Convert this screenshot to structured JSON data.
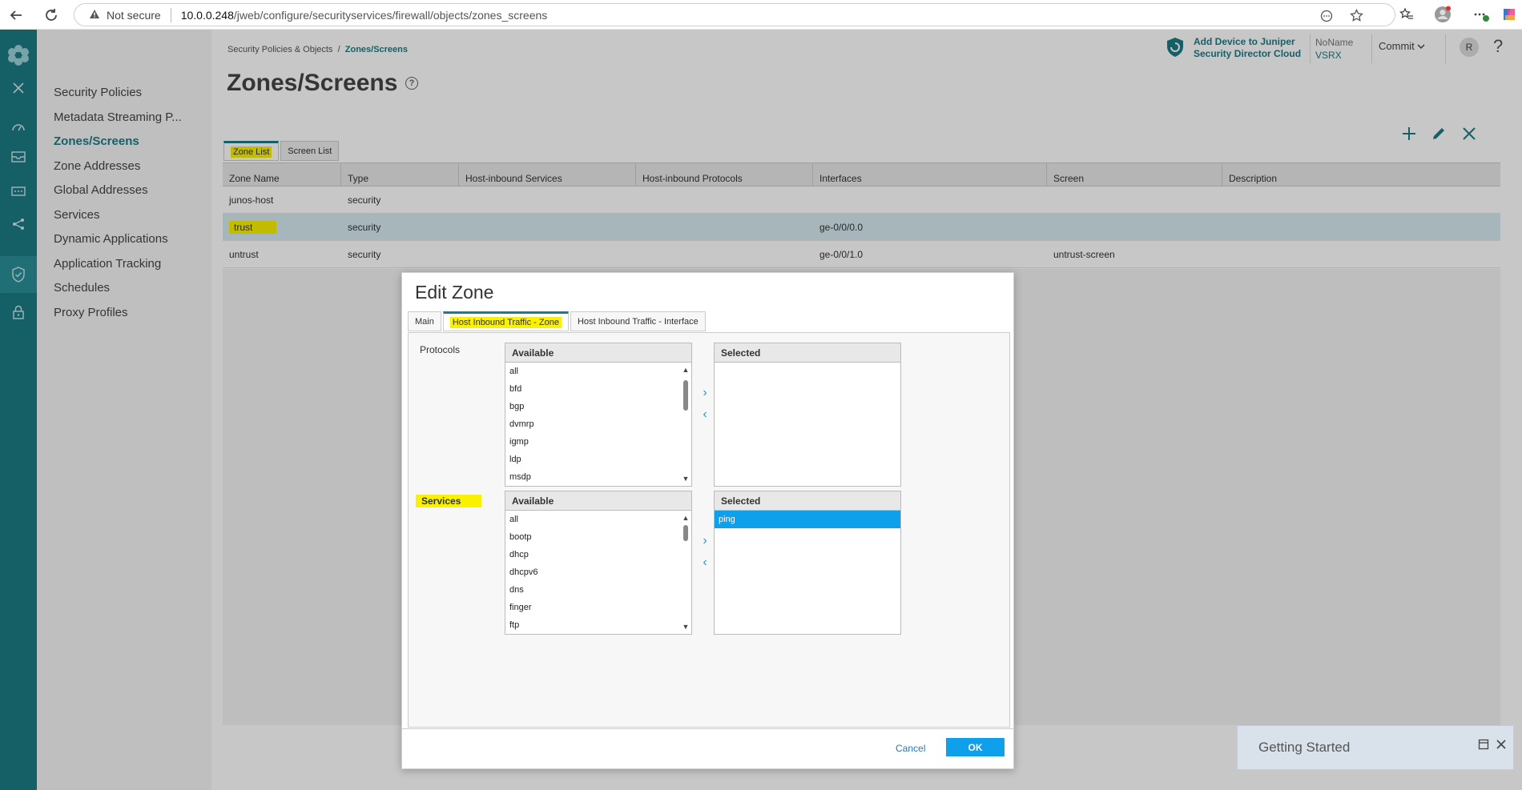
{
  "browser": {
    "not_secure": "Not secure",
    "url_host": "10.0.0.248",
    "url_path": "/jweb/configure/securityservices/firewall/objects/zones_screens"
  },
  "nav": {
    "items": [
      {
        "label": "Security Policies"
      },
      {
        "label": "Metadata Streaming P..."
      },
      {
        "label": "Zones/Screens"
      },
      {
        "label": "Zone Addresses"
      },
      {
        "label": "Global Addresses"
      },
      {
        "label": "Services"
      },
      {
        "label": "Dynamic Applications"
      },
      {
        "label": "Application Tracking"
      },
      {
        "label": "Schedules"
      },
      {
        "label": "Proxy Profiles"
      }
    ]
  },
  "header": {
    "breadcrumb_parent": "Security Policies & Objects",
    "breadcrumb_sep": "/",
    "breadcrumb_current": "Zones/Screens",
    "title": "Zones/Screens",
    "sd_line1": "Add Device to Juniper",
    "sd_line2": "Security Director Cloud",
    "device_name": "NoName",
    "device_model": "VSRX",
    "commit": "Commit",
    "user_initial": "R"
  },
  "list_tabs": {
    "zone_list": "Zone List",
    "screen_list": "Screen List"
  },
  "grid": {
    "columns": [
      "Zone Name",
      "Type",
      "Host-inbound Services",
      "Host-inbound Protocols",
      "Interfaces",
      "Screen",
      "Description"
    ],
    "rows": [
      [
        "junos-host",
        "security",
        "",
        "",
        "",
        "",
        ""
      ],
      [
        "trust",
        "security",
        "",
        "",
        "ge-0/0/0.0",
        "",
        ""
      ],
      [
        "untrust",
        "security",
        "",
        "",
        "ge-0/0/1.0",
        "untrust-screen",
        ""
      ]
    ]
  },
  "modal": {
    "title": "Edit Zone",
    "tabs": [
      "Main",
      "Host Inbound Traffic - Zone",
      "Host Inbound Traffic - Interface"
    ],
    "protocols_label": "Protocols",
    "services_label": "Services",
    "available": "Available",
    "selected": "Selected",
    "protocols_available": [
      "all",
      "bfd",
      "bgp",
      "dvmrp",
      "igmp",
      "ldp",
      "msdp"
    ],
    "services_available": [
      "all",
      "bootp",
      "dhcp",
      "dhcpv6",
      "dns",
      "finger",
      "ftp"
    ],
    "services_selected": [
      "ping"
    ],
    "cancel": "Cancel",
    "ok": "OK"
  },
  "getting_started": {
    "title": "Getting Started"
  },
  "colors": {
    "accent": "#1c7b84",
    "highlight": "#f9f100",
    "select_blue": "#0ea0ea"
  }
}
